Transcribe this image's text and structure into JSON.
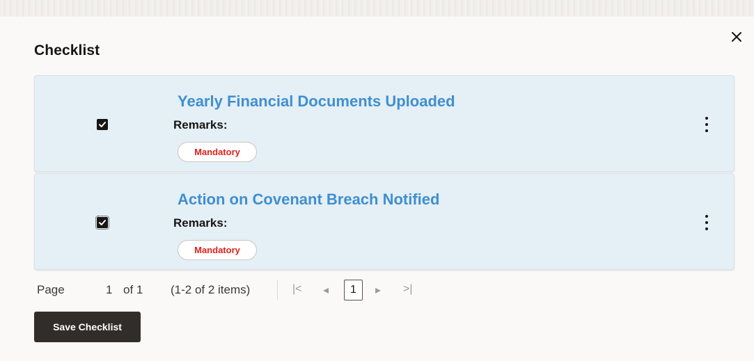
{
  "dialog": {
    "title": "Checklist",
    "close_icon": "close-icon"
  },
  "checklist": {
    "items": [
      {
        "title": "Yearly Financial Documents Uploaded",
        "remarks_label": "Remarks:",
        "badge": "Mandatory",
        "checked": true
      },
      {
        "title": "Action on Covenant Breach Notified",
        "remarks_label": "Remarks:",
        "badge": "Mandatory",
        "checked": true
      }
    ]
  },
  "pagination": {
    "page_label": "Page",
    "page_number": "1",
    "of_label": "of 1",
    "items_info": "(1-2 of 2 items)",
    "current_page": "1",
    "first_icon": "|<",
    "prev_icon": "◂",
    "next_icon": "▸",
    "last_icon": ">|"
  },
  "actions": {
    "save_label": "Save Checklist"
  },
  "colors": {
    "card_bg": "#e5eff6",
    "title_link": "#3f8fcf",
    "badge_text": "#e0201b",
    "button_bg": "#312d2a"
  }
}
